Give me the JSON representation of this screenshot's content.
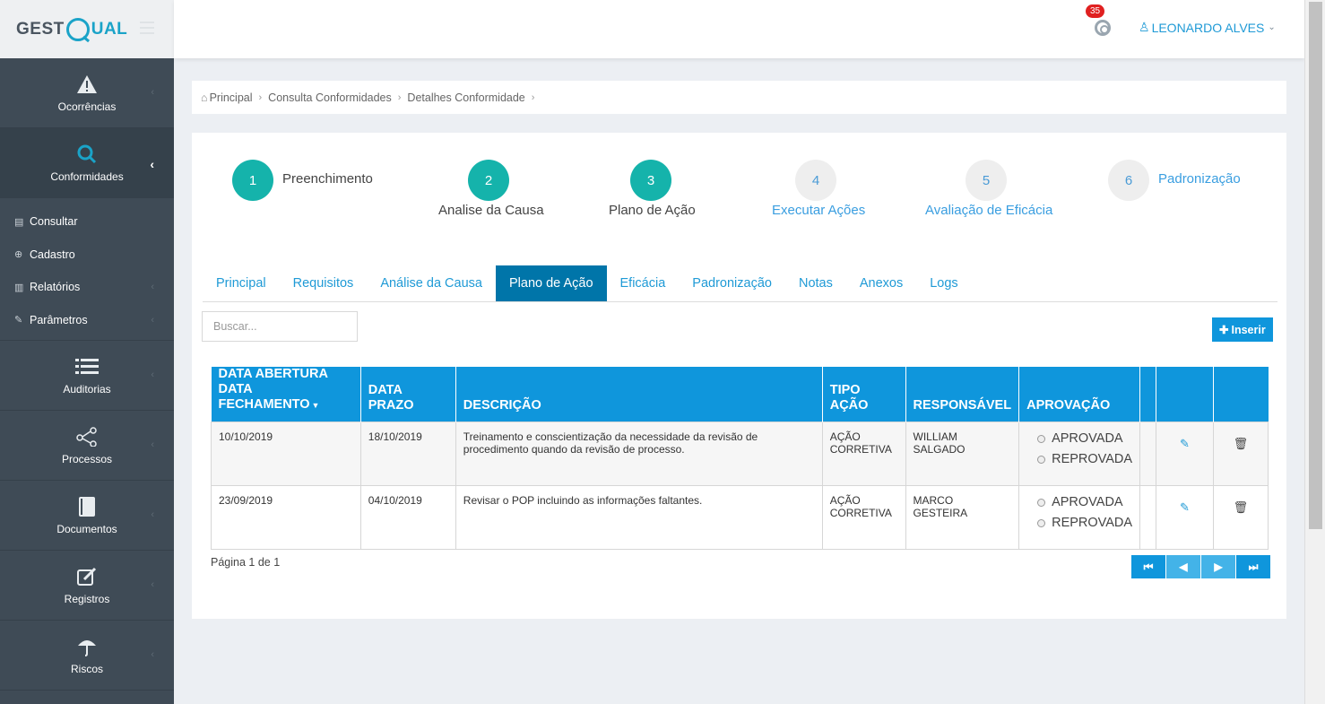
{
  "brand": {
    "part1": "GEST",
    "part2": "UAL"
  },
  "topbar": {
    "notifications": "35",
    "user": "LEONARDO ALVES"
  },
  "sidebar": {
    "items": [
      {
        "label": "Ocorrências",
        "icon": "warning-icon"
      },
      {
        "label": "Conformidades",
        "icon": "search-icon"
      }
    ],
    "sub": [
      {
        "label": "Consultar",
        "icon": "table-icon"
      },
      {
        "label": "Cadastro",
        "icon": "plus-circle-icon"
      },
      {
        "label": "Relatórios",
        "icon": "bar-chart-icon"
      },
      {
        "label": "Parâmetros",
        "icon": "wrench-icon"
      }
    ],
    "items2": [
      {
        "label": "Auditorias",
        "icon": "list-icon"
      },
      {
        "label": "Processos",
        "icon": "share-icon"
      },
      {
        "label": "Documentos",
        "icon": "book-icon"
      },
      {
        "label": "Registros",
        "icon": "edit-icon"
      },
      {
        "label": "Riscos",
        "icon": "umbrella-icon"
      }
    ]
  },
  "breadcrumb": [
    "Principal",
    "Consulta Conformidades",
    "Detalhes Conformidade"
  ],
  "wizard": [
    {
      "num": "1",
      "label": "Preenchimento"
    },
    {
      "num": "2",
      "label": "Analise da Causa"
    },
    {
      "num": "3",
      "label": "Plano de Ação"
    },
    {
      "num": "4",
      "label": "Executar Ações"
    },
    {
      "num": "5",
      "label": "Avaliação de Eficácia"
    },
    {
      "num": "6",
      "label": "Padronização"
    }
  ],
  "tabs": [
    "Principal",
    "Requisitos",
    "Análise da Causa",
    "Plano de Ação",
    "Eficácia",
    "Padronização",
    "Notas",
    "Anexos",
    "Logs"
  ],
  "search": {
    "placeholder": "Buscar..."
  },
  "insert_label": "Inserir",
  "table": {
    "headers": {
      "abertura": "DATA ABERTURA",
      "fechamento": "DATA FECHAMENTO",
      "prazo": "DATA PRAZO",
      "descricao": "DESCRIÇÃO",
      "tipo": "TIPO AÇÃO",
      "responsavel": "RESPONSÁVEL",
      "aprovacao": "APROVAÇÃO"
    },
    "rows": [
      {
        "abertura": "10/10/2019",
        "prazo": "18/10/2019",
        "descricao": "Treinamento e conscientização da necessidade da revisão de procedimento quando da revisão de processo.",
        "tipo_1": "AÇÃO",
        "tipo_2": "CORRETIVA",
        "resp_1": "WILLIAM",
        "resp_2": "SALGADO",
        "aprovada": "APROVADA",
        "reprovada": "REPROVADA"
      },
      {
        "abertura": "23/09/2019",
        "prazo": "04/10/2019",
        "descricao": "Revisar o POP incluindo as informações faltantes.",
        "tipo_1": "AÇÃO",
        "tipo_2": "CORRETIVA",
        "resp_1": "MARCO",
        "resp_2": "GESTEIRA",
        "aprovada": "APROVADA",
        "reprovada": "REPROVADA"
      }
    ]
  },
  "page_info": "Página 1 de 1"
}
